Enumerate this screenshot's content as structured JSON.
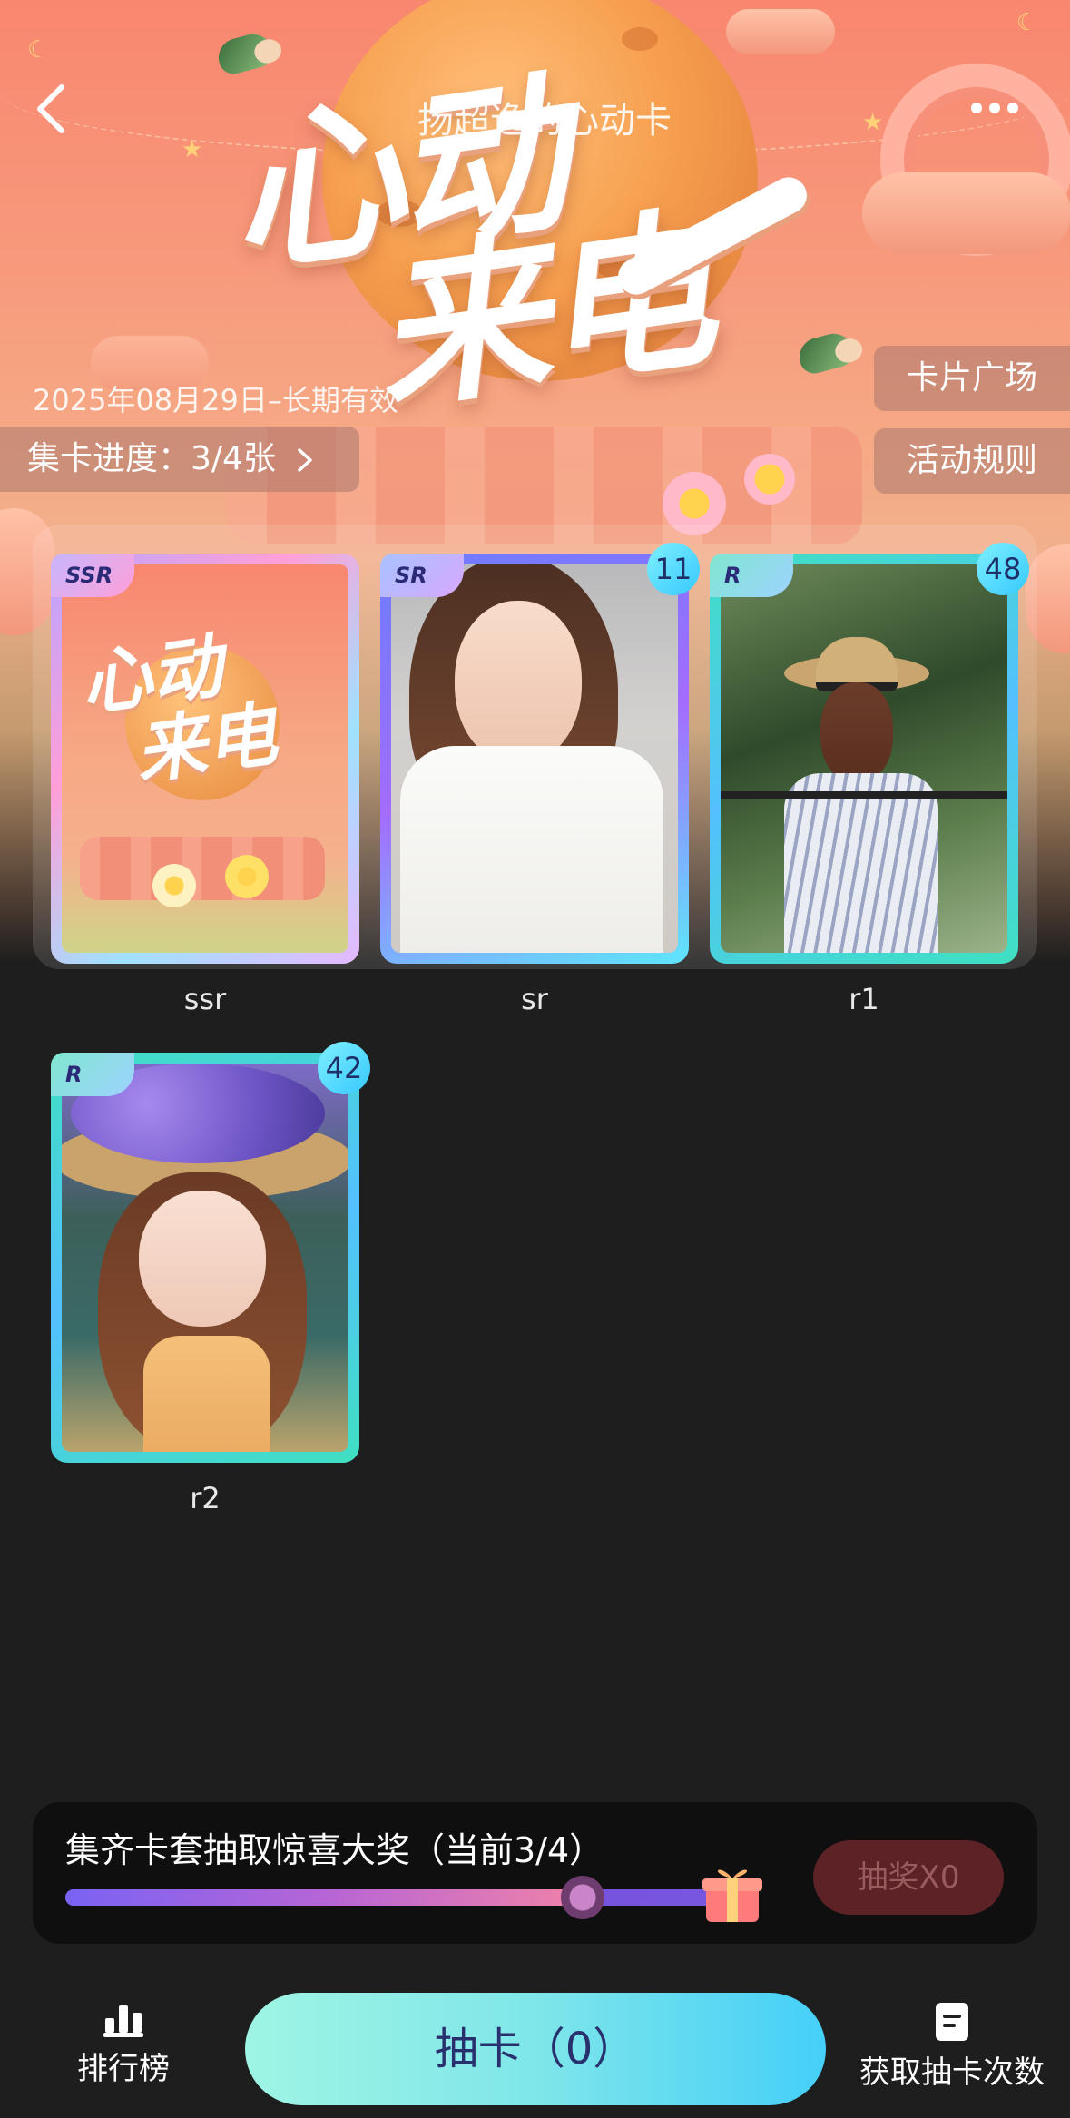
{
  "header": {
    "title": "扬超逸的心动卡",
    "validity": "2025年08月29日–长期有效"
  },
  "logo": {
    "line1": "心动",
    "line2": "来电"
  },
  "progress_pill": {
    "label": "集卡进度：3/4张"
  },
  "side_buttons": {
    "plaza": "卡片广场",
    "rules": "活动规则"
  },
  "cards": [
    {
      "tier": "SSR",
      "name": "ssr",
      "count": ""
    },
    {
      "tier": "SR",
      "name": "sr",
      "count": "11"
    },
    {
      "tier": "R",
      "name": "r1",
      "count": "48"
    },
    {
      "tier": "R",
      "name": "r2",
      "count": "42"
    }
  ],
  "collect": {
    "title": "集齐卡套抽取惊喜大奖（当前3/4）",
    "progress": 0.75,
    "draw_label": "抽奖X0"
  },
  "bottom_nav": {
    "rank_label": "排行榜",
    "draw_card_label": "抽卡（0）",
    "get_chances_label": "获取抽卡次数"
  },
  "icons": [
    "back-icon",
    "more-icon",
    "chevron-right-icon",
    "gift-icon",
    "ranking-icon",
    "task-icon"
  ],
  "colors": {
    "background": "#1e1e1e",
    "primary_button_start": "#9ff5e4",
    "primary_button_end": "#45cff9",
    "count_badge": "#36c8ff"
  }
}
